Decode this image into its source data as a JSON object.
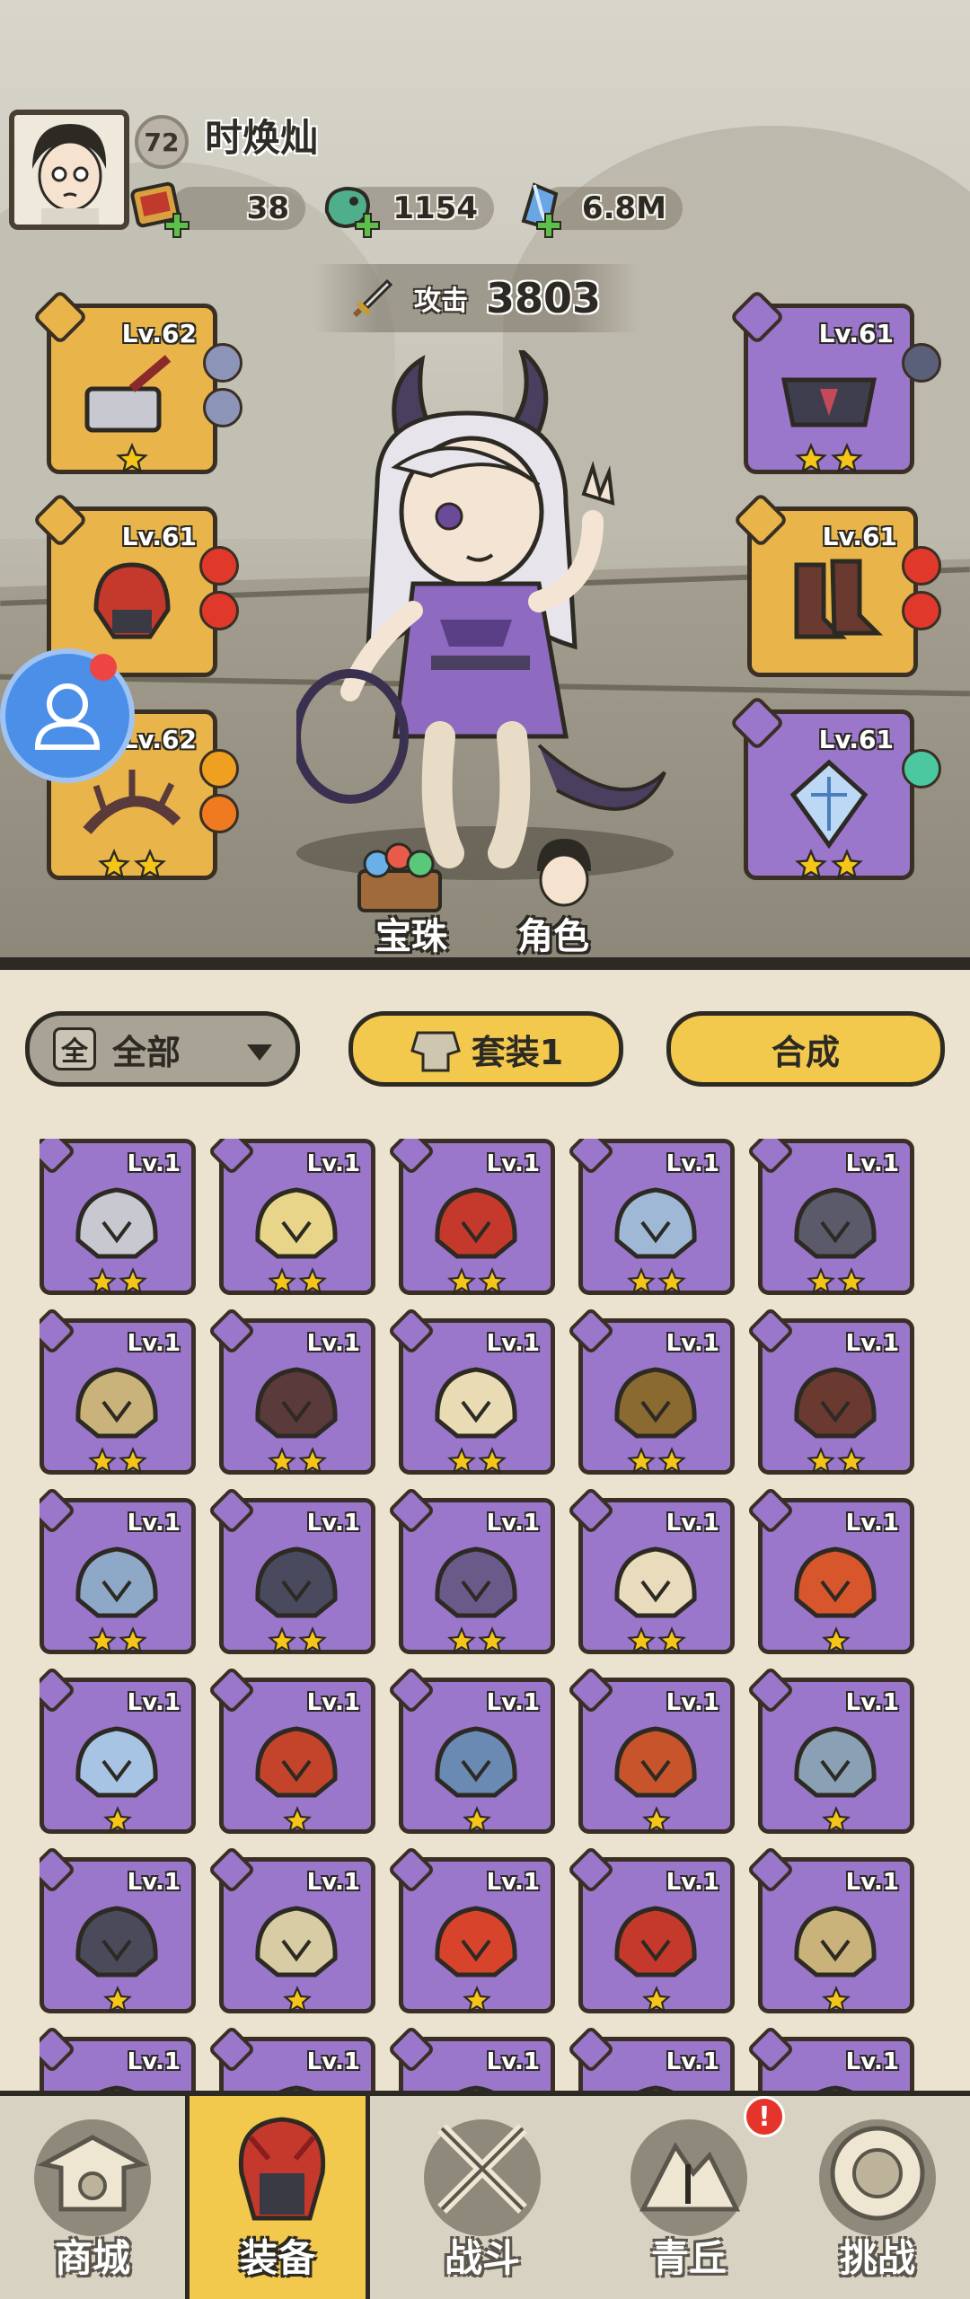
{
  "player": {
    "level": "72",
    "name": "时焕灿"
  },
  "resources": [
    {
      "icon": "scroll-ticket-icon",
      "value": "38"
    },
    {
      "icon": "jade-dragon-icon",
      "value": "1154"
    },
    {
      "icon": "blue-crystal-icon",
      "value": "6.8M"
    }
  ],
  "attack": {
    "label": "攻击",
    "value": "3803"
  },
  "equipped": [
    {
      "slot": "weapon",
      "level": "Lv.62",
      "rarity": "gold",
      "stars": 1,
      "icon": "hammer-weapon-icon",
      "orbs": [
        "#8c95b8",
        "#8c95b8"
      ]
    },
    {
      "slot": "helmet",
      "level": "Lv.61",
      "rarity": "gold",
      "stars": 0,
      "icon": "red-helmet-icon",
      "orbs": [
        "#e0392b",
        "#e0392b"
      ]
    },
    {
      "slot": "accessory",
      "level": "Lv.62",
      "rarity": "gold",
      "stars": 2,
      "icon": "thorn-horn-icon",
      "orbs": [
        "#f0a020",
        "#f07a20"
      ]
    },
    {
      "slot": "belt",
      "level": "Lv.61",
      "rarity": "purple",
      "stars": 2,
      "icon": "dark-belt-icon",
      "orbs": [
        "#5a5f7a"
      ]
    },
    {
      "slot": "boots",
      "level": "Lv.61",
      "rarity": "gold",
      "stars": 0,
      "icon": "red-boots-icon",
      "orbs": [
        "#e0392b",
        "#e0392b"
      ]
    },
    {
      "slot": "amulet",
      "level": "Lv.61",
      "rarity": "purple",
      "stars": 2,
      "icon": "crystal-amulet-icon",
      "orbs": [
        "#4bc8a0"
      ]
    }
  ],
  "center_buttons": {
    "gems": "宝珠",
    "character": "角色"
  },
  "filters": {
    "all_box": "全",
    "all_label": "全部",
    "set_label": "套装1",
    "craft_label": "合成"
  },
  "inventory": [
    {
      "level": "Lv.1",
      "stars": 2,
      "icon": "hammer-weapon-icon",
      "art": "#c8c8d0"
    },
    {
      "level": "Lv.1",
      "stars": 2,
      "icon": "golden-staff-icon",
      "art": "#e8d58a"
    },
    {
      "level": "Lv.1",
      "stars": 2,
      "icon": "red-helmet-icon",
      "art": "#c4392b"
    },
    {
      "level": "Lv.1",
      "stars": 2,
      "icon": "ice-helmet-icon",
      "art": "#9fb8d6"
    },
    {
      "level": "Lv.1",
      "stars": 2,
      "icon": "dark-armor-icon",
      "art": "#5a5a6a"
    },
    {
      "level": "Lv.1",
      "stars": 2,
      "icon": "golden-armor-icon",
      "art": "#c9b37a"
    },
    {
      "level": "Lv.1",
      "stars": 2,
      "icon": "thorn-horn-icon",
      "art": "#5a3a3a"
    },
    {
      "level": "Lv.1",
      "stars": 2,
      "icon": "feather-claw-icon",
      "art": "#e9dcb4"
    },
    {
      "level": "Lv.1",
      "stars": 2,
      "icon": "gold-belt-icon",
      "art": "#8a6a30"
    },
    {
      "level": "Lv.1",
      "stars": 2,
      "icon": "red-boots-icon",
      "art": "#6a3a30"
    },
    {
      "level": "Lv.1",
      "stars": 2,
      "icon": "ice-boots-icon",
      "art": "#8ea8c8"
    },
    {
      "level": "Lv.1",
      "stars": 2,
      "icon": "dark-boots-icon",
      "art": "#4a4a5e"
    },
    {
      "level": "Lv.1",
      "stars": 2,
      "icon": "orb-pendant-icon",
      "art": "#6a5a8a"
    },
    {
      "level": "Lv.1",
      "stars": 2,
      "icon": "fang-necklace-icon",
      "art": "#e8dcbc"
    },
    {
      "level": "Lv.1",
      "stars": 1,
      "icon": "fire-wand-icon",
      "art": "#d8562b"
    },
    {
      "level": "Lv.1",
      "stars": 1,
      "icon": "ice-bow-icon",
      "art": "#a8c4e4"
    },
    {
      "level": "Lv.1",
      "stars": 1,
      "icon": "red-horn-icon",
      "art": "#c4442b"
    },
    {
      "level": "Lv.1",
      "stars": 1,
      "icon": "ice-antler-icon",
      "art": "#6a8ab4"
    },
    {
      "level": "Lv.1",
      "stars": 1,
      "icon": "lotus-belt-icon",
      "art": "#c8542b"
    },
    {
      "level": "Lv.1",
      "stars": 1,
      "icon": "fur-belt-icon",
      "art": "#8aa0b4"
    },
    {
      "level": "Lv.1",
      "stars": 1,
      "icon": "dark-belt-icon",
      "art": "#4a4a5a"
    },
    {
      "level": "Lv.1",
      "stars": 1,
      "icon": "bone-boots-icon",
      "art": "#d8cca4"
    },
    {
      "level": "Lv.1",
      "stars": 1,
      "icon": "flame-orb-icon",
      "art": "#d8442b"
    },
    {
      "level": "Lv.1",
      "stars": 1,
      "icon": "red-helmet-icon",
      "art": "#c4392b"
    },
    {
      "level": "Lv.1",
      "stars": 1,
      "icon": "golden-armor-icon",
      "art": "#c9b37a"
    },
    {
      "level": "Lv.1",
      "stars": 0,
      "icon": "item-icon",
      "art": "#8a7aa4"
    },
    {
      "level": "Lv.1",
      "stars": 0,
      "icon": "item-icon",
      "art": "#8a7aa4"
    },
    {
      "level": "Lv.1",
      "stars": 0,
      "icon": "item-icon",
      "art": "#8a7aa4"
    },
    {
      "level": "Lv.1",
      "stars": 0,
      "icon": "item-icon",
      "art": "#8a7aa4"
    },
    {
      "level": "Lv.1",
      "stars": 0,
      "icon": "item-icon",
      "art": "#8a7aa4"
    }
  ],
  "nav": [
    {
      "label": "商城",
      "icon": "shop-pagoda-icon",
      "active": false
    },
    {
      "label": "装备",
      "icon": "equipment-helmet-icon",
      "active": true
    },
    {
      "label": "战斗",
      "icon": "crossed-swords-icon",
      "active": false
    },
    {
      "label": "青丘",
      "icon": "mountain-emblem-icon",
      "active": false
    },
    {
      "label": "挑战",
      "icon": "challenge-orb-icon",
      "active": false
    }
  ],
  "alert_badge": "!",
  "colors": {
    "gold_slot": "#e9b54a",
    "purple_slot": "#9b77cc",
    "button_yellow": "#f2c94c",
    "dark_outline": "#2d2a24"
  }
}
